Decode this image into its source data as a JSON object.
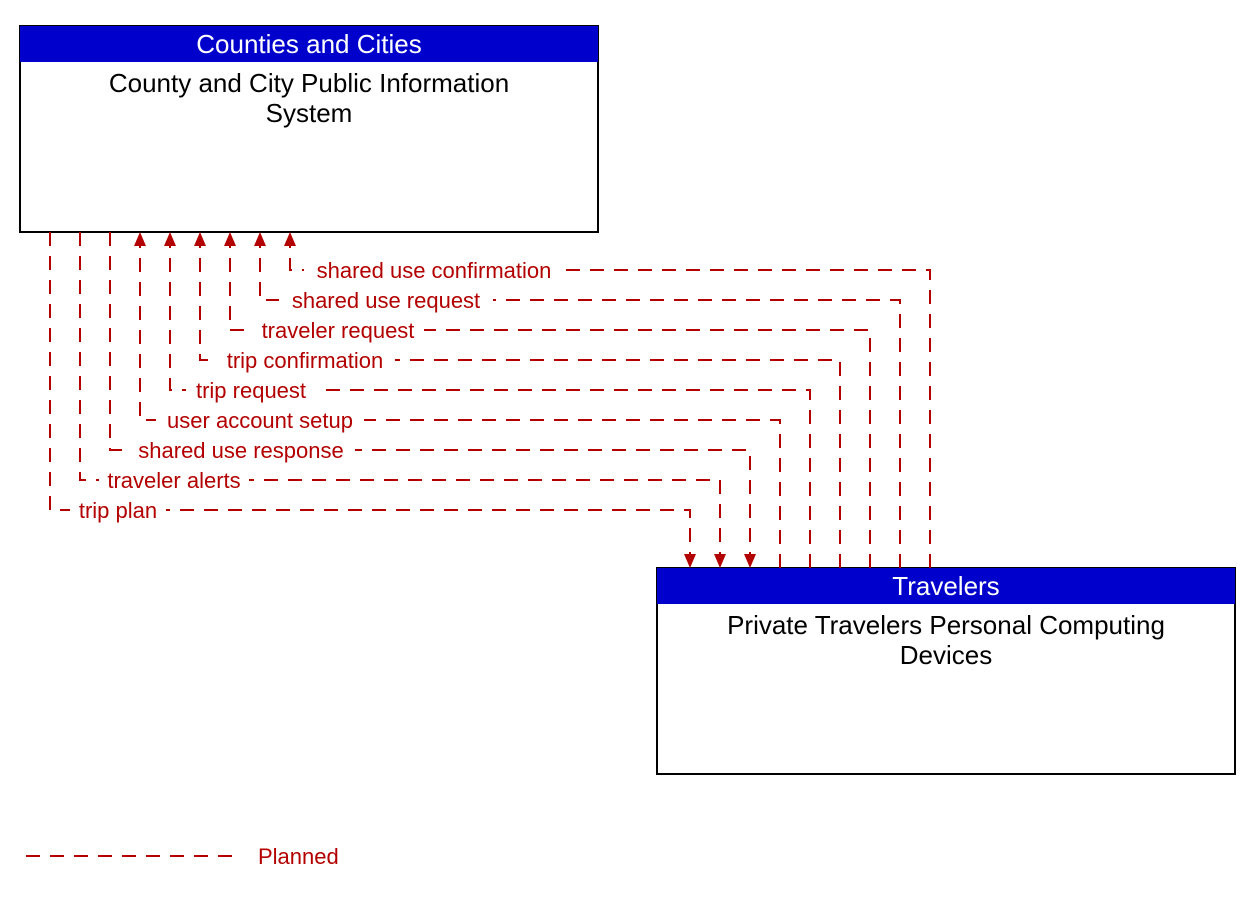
{
  "colors": {
    "header_bg": "#0000cc",
    "header_text": "#ffffff",
    "body_text": "#000000",
    "flow": "#b30000"
  },
  "boxes": {
    "top": {
      "header": "Counties and Cities",
      "body_line1": "County and City Public Information",
      "body_line2": "System"
    },
    "bottom": {
      "header": "Travelers",
      "body_line1": "Private Travelers Personal Computing",
      "body_line2": "Devices"
    }
  },
  "flows": [
    {
      "label": "shared use confirmation"
    },
    {
      "label": "shared use request"
    },
    {
      "label": "traveler request"
    },
    {
      "label": "trip confirmation"
    },
    {
      "label": "trip request"
    },
    {
      "label": "user account setup"
    },
    {
      "label": "shared use response"
    },
    {
      "label": "traveler alerts"
    },
    {
      "label": "trip plan"
    }
  ],
  "legend": {
    "planned": "Planned"
  }
}
